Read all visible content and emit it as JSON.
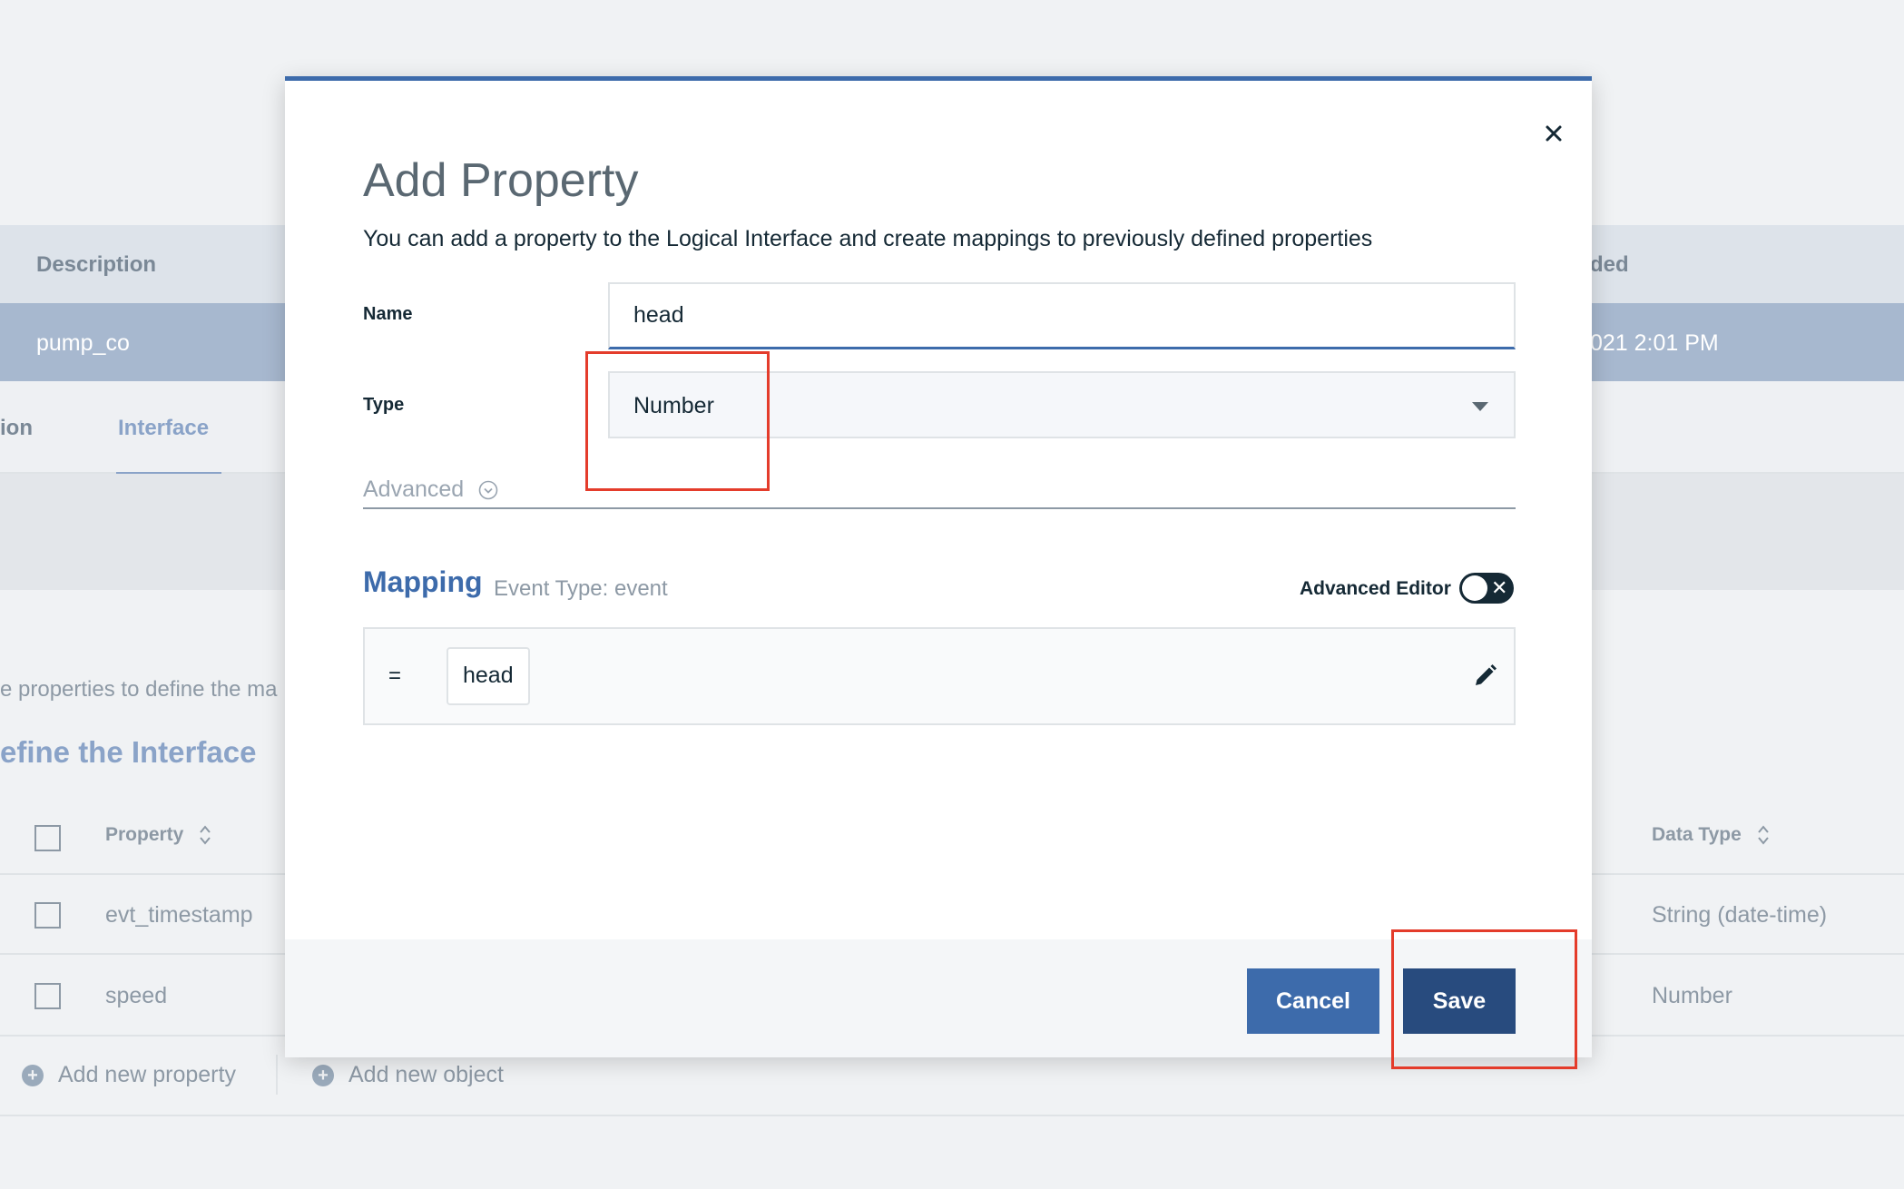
{
  "background": {
    "top_text": "",
    "table_headers": {
      "description": "Description",
      "added": "ded"
    },
    "selected_row": {
      "description": "pump_co",
      "added": "021 2:01 PM"
    },
    "tabs": {
      "left": "ion",
      "interface": "Interface"
    },
    "help_text": "e properties to define the ma",
    "section_title": "efine the Interface",
    "columns": {
      "property": "Property",
      "data_type": "Data Type"
    },
    "rows": [
      {
        "property": "evt_timestamp",
        "data_type": "String (date-time)"
      },
      {
        "property": "speed",
        "data_type": "Number"
      }
    ],
    "add_property": "Add new property",
    "add_object": "Add new object"
  },
  "modal": {
    "title": "Add Property",
    "description": "You can add a property to the Logical Interface and create mappings to previously defined properties",
    "name_label": "Name",
    "name_value": "head",
    "type_label": "Type",
    "type_value": "Number",
    "advanced_label": "Advanced",
    "mapping_title": "Mapping",
    "mapping_subtitle": "Event Type: event",
    "advanced_editor_label": "Advanced Editor",
    "advanced_editor_on": false,
    "mapping_operator": "=",
    "mapping_token": "head",
    "cancel_label": "Cancel",
    "save_label": "Save"
  },
  "colors": {
    "accent": "#3d6bab",
    "save_button": "#284b7e",
    "highlight": "#e43c2b"
  },
  "icons": [
    "close-icon",
    "chevron-down-icon",
    "caret-down-icon",
    "pencil-icon",
    "sort-icon",
    "plus-circle-icon"
  ]
}
